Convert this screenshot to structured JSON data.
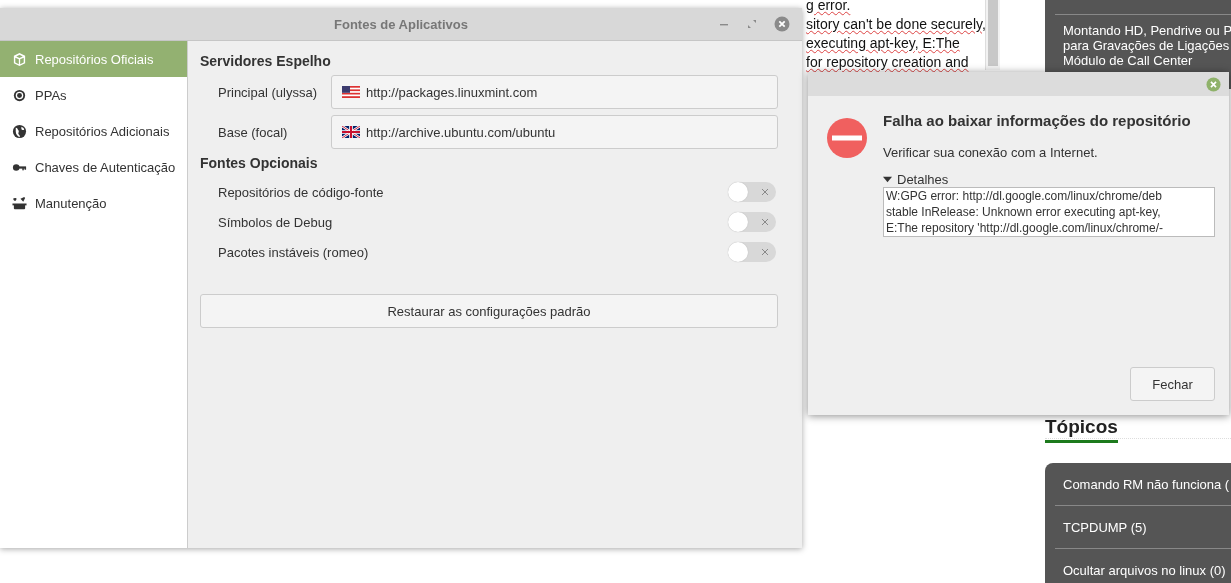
{
  "background_page": {
    "article_lines": [
      "g error.",
      "sitory can't be done securely,",
      "executing apt-key, E:The",
      "for repository creation and"
    ],
    "sidebar_post": [
      "Montando HD, Pendrive ou P",
      "para Gravações de Ligações",
      "Módulo de Call Center"
    ],
    "topics_heading": "Tópicos",
    "topics": [
      "Comando RM não funciona (",
      "TCPDUMP (5)",
      "Ocultar arquivos no linux (0)"
    ]
  },
  "window": {
    "title": "Fontes de Aplicativos",
    "sidebar": [
      {
        "label": "Repositórios Oficiais",
        "selected": true
      },
      {
        "label": "PPAs",
        "selected": false
      },
      {
        "label": "Repositórios Adicionais",
        "selected": false
      },
      {
        "label": "Chaves de Autenticação",
        "selected": false
      },
      {
        "label": "Manutenção",
        "selected": false
      }
    ],
    "mirrors": {
      "heading": "Servidores Espelho",
      "rows": [
        {
          "label": "Principal (ulyssa)",
          "url": "http://packages.linuxmint.com"
        },
        {
          "label": "Base (focal)",
          "url": "http://archive.ubuntu.com/ubuntu"
        }
      ]
    },
    "optional": {
      "heading": "Fontes Opcionais",
      "rows": [
        {
          "label": "Repositórios de código-fonte",
          "on": false
        },
        {
          "label": "Símbolos de Debug",
          "on": false
        },
        {
          "label": "Pacotes instáveis (romeo)",
          "on": false
        }
      ]
    },
    "restore_button": "Restaurar as configurações padrão"
  },
  "dialog": {
    "heading": "Falha ao baixar informações do repositório",
    "message": "Verificar sua conexão com a Internet.",
    "details": {
      "label": "Detalhes",
      "expanded": true,
      "lines": [
        "W:GPG error: http://dl.google.com/linux/chrome/deb",
        "stable InRelease: Unknown error executing apt-key,",
        "E:The repository 'http://dl.google.com/linux/chrome/-"
      ]
    },
    "button": "Fechar"
  }
}
